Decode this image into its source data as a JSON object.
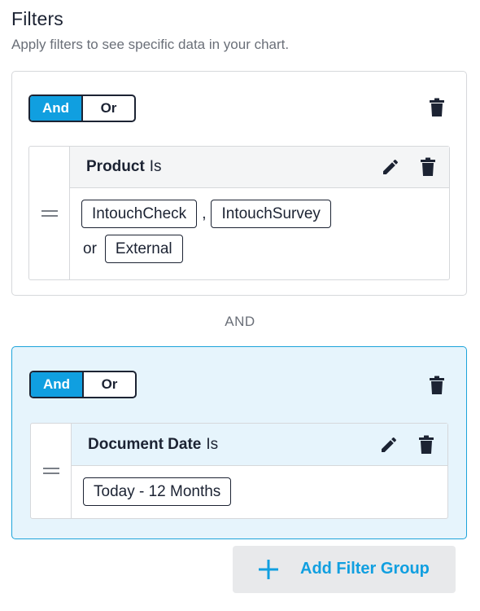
{
  "header": {
    "title": "Filters",
    "subtitle": "Apply filters to see specific data in your chart."
  },
  "groups": [
    {
      "toggle": {
        "and_label": "And",
        "or_label": "Or",
        "selected": "And"
      },
      "rule": {
        "field": "Product",
        "operator": "Is",
        "values": [
          "IntouchCheck",
          "IntouchSurvey",
          "External"
        ],
        "separator_comma": ",",
        "separator_or": "or"
      }
    },
    {
      "toggle": {
        "and_label": "And",
        "or_label": "Or",
        "selected": "And"
      },
      "rule": {
        "field": "Document Date",
        "operator": "Is",
        "values": [
          "Today - 12 Months"
        ]
      }
    }
  ],
  "group_joiner": "AND",
  "add_button": {
    "label": "Add Filter Group",
    "icon": "plus-icon"
  },
  "colors": {
    "accent": "#109fe0",
    "selected_group_bg": "#e6f4fc",
    "selected_group_border": "#1ca3da",
    "text": "#1c2333"
  }
}
